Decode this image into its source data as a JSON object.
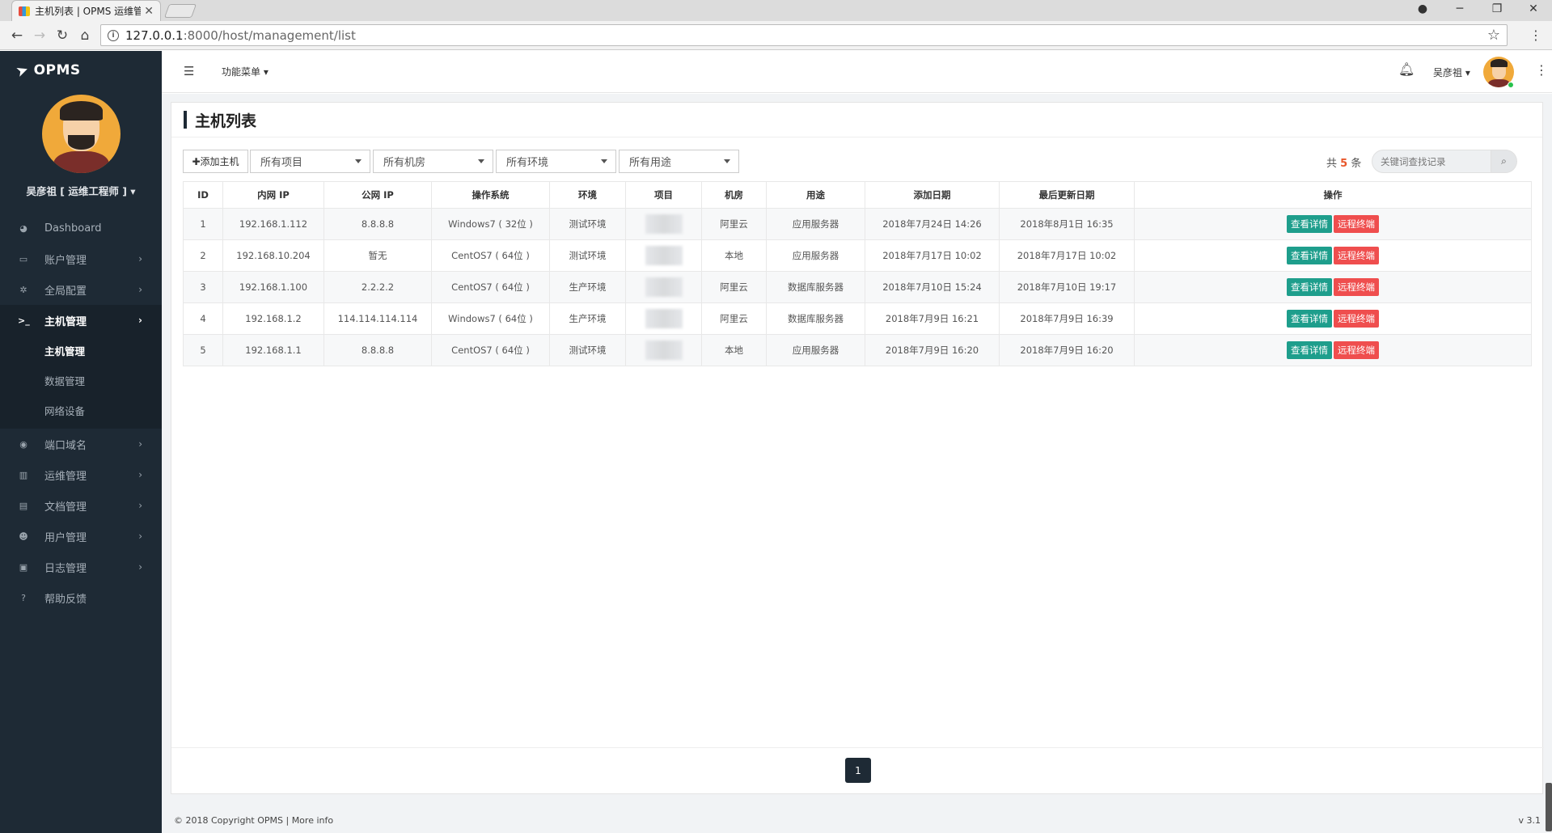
{
  "browser": {
    "tab_title": "主机列表 | OPMS 运维管",
    "tab_close": "✕",
    "url_host": "127.0.0.1",
    "url_path": ":8000/host/management/list"
  },
  "sidebar": {
    "brand": "OPMS",
    "profile_name": "吴彦祖 [ 运维工程师 ] ▾",
    "items": [
      {
        "label": "Dashboard",
        "icon": "◕"
      },
      {
        "label": "账户管理",
        "icon": "▭"
      },
      {
        "label": "全局配置",
        "icon": "✲"
      },
      {
        "label": "主机管理",
        "icon": ">_"
      },
      {
        "label": "端口域名",
        "icon": "◉"
      },
      {
        "label": "运维管理",
        "icon": "▥"
      },
      {
        "label": "文档管理",
        "icon": "▤"
      },
      {
        "label": "用户管理",
        "icon": "☻"
      },
      {
        "label": "日志管理",
        "icon": "▣"
      },
      {
        "label": "帮助反馈",
        "icon": "?"
      }
    ],
    "subitems": [
      {
        "label": "主机管理"
      },
      {
        "label": "数据管理"
      },
      {
        "label": "网络设备"
      }
    ]
  },
  "header": {
    "func_menu": "功能菜单 ▾",
    "user_name": "吴彦祖 ▾"
  },
  "page": {
    "title": "主机列表",
    "add_button": "✚添加主机",
    "filters": [
      "所有项目",
      "所有机房",
      "所有环境",
      "所有用途"
    ],
    "count_prefix": "共",
    "count_value": "5",
    "count_suffix": "条",
    "search_placeholder": "关键词查找记录"
  },
  "table": {
    "headers": [
      "ID",
      "内网 IP",
      "公网 IP",
      "操作系统",
      "环境",
      "项目",
      "机房",
      "用途",
      "添加日期",
      "最后更新日期",
      "操作"
    ],
    "rows": [
      {
        "id": "1",
        "lan": "192.168.1.112",
        "wan": "8.8.8.8",
        "os": "Windows7 ( 32位 )",
        "env": "测试环境",
        "room": "阿里云",
        "use": "应用服务器",
        "added": "2018年7月24日 14:26",
        "updated": "2018年8月1日 16:35"
      },
      {
        "id": "2",
        "lan": "192.168.10.204",
        "wan": "暂无",
        "os": "CentOS7 ( 64位 )",
        "env": "测试环境",
        "room": "本地",
        "use": "应用服务器",
        "added": "2018年7月17日 10:02",
        "updated": "2018年7月17日 10:02"
      },
      {
        "id": "3",
        "lan": "192.168.1.100",
        "wan": "2.2.2.2",
        "os": "CentOS7 ( 64位 )",
        "env": "生产环境",
        "room": "阿里云",
        "use": "数据库服务器",
        "added": "2018年7月10日 15:24",
        "updated": "2018年7月10日 19:17"
      },
      {
        "id": "4",
        "lan": "192.168.1.2",
        "wan": "114.114.114.114",
        "os": "Windows7 ( 64位 )",
        "env": "生产环境",
        "room": "阿里云",
        "use": "数据库服务器",
        "added": "2018年7月9日 16:21",
        "updated": "2018年7月9日 16:39"
      },
      {
        "id": "5",
        "lan": "192.168.1.1",
        "wan": "8.8.8.8",
        "os": "CentOS7 ( 64位 )",
        "env": "测试环境",
        "room": "本地",
        "use": "应用服务器",
        "added": "2018年7月9日 16:20",
        "updated": "2018年7月9日 16:20"
      }
    ],
    "view_label": "查看详情",
    "remote_label": "远程终端"
  },
  "pagination": {
    "current": "1"
  },
  "footer": {
    "copyright": "© 2018 Copyright OPMS | More info",
    "version": "v 3.1"
  },
  "colors": {
    "sidebar_bg": "#1e2a35",
    "btn_view": "#1e9e8c",
    "btn_remote": "#ef4e4e",
    "count_accent": "#e8562a"
  }
}
